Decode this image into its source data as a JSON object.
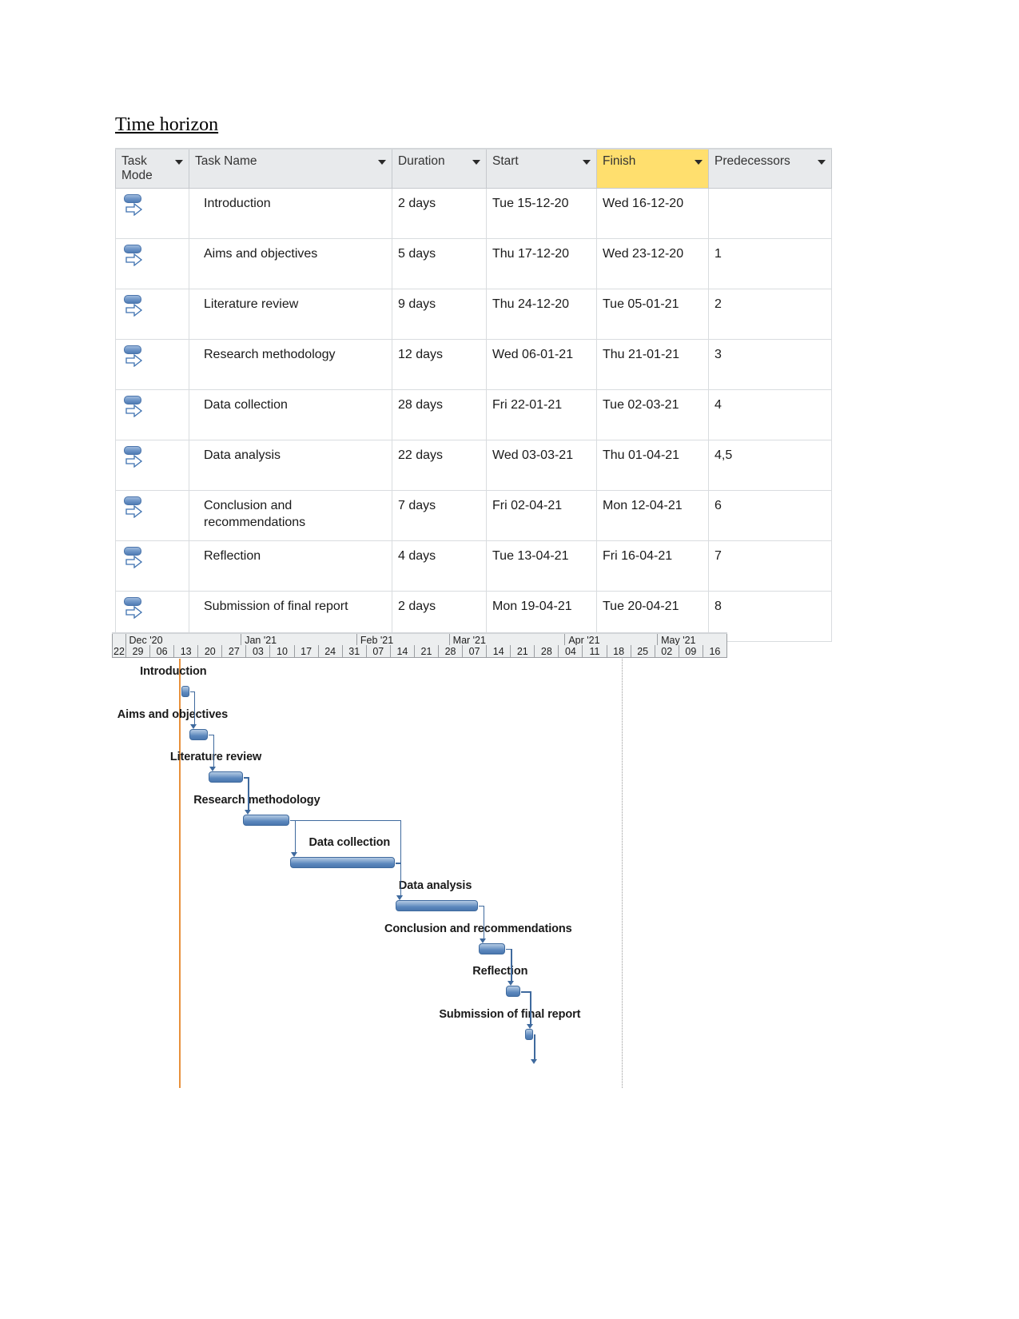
{
  "heading": "Time horizon",
  "grid": {
    "columns": [
      {
        "label": "Task Mode",
        "key": "mode",
        "has_filter": true,
        "highlight": false
      },
      {
        "label": "Task Name",
        "key": "name",
        "has_filter": true,
        "highlight": false
      },
      {
        "label": "Duration",
        "key": "duration",
        "has_filter": true,
        "highlight": false
      },
      {
        "label": "Start",
        "key": "start",
        "has_filter": true,
        "highlight": false
      },
      {
        "label": "Finish",
        "key": "finish",
        "has_filter": true,
        "highlight": true
      },
      {
        "label": "Predecessors",
        "key": "predecessors",
        "has_filter": true,
        "highlight": false
      }
    ],
    "finish_header_color": "#ffdf6e",
    "mode_icon": "auto-scheduled-icon",
    "rows": [
      {
        "id": 1,
        "name": "Introduction",
        "duration": "2 days",
        "start": "Tue 15-12-20",
        "finish": "Wed 16-12-20",
        "predecessors": ""
      },
      {
        "id": 2,
        "name": "Aims and objectives",
        "duration": "5 days",
        "start": "Thu 17-12-20",
        "finish": "Wed 23-12-20",
        "predecessors": "1"
      },
      {
        "id": 3,
        "name": "Literature review",
        "duration": "9 days",
        "start": "Thu 24-12-20",
        "finish": "Tue 05-01-21",
        "predecessors": "2"
      },
      {
        "id": 4,
        "name": "Research methodology",
        "duration": "12 days",
        "start": "Wed 06-01-21",
        "finish": "Thu 21-01-21",
        "predecessors": "3"
      },
      {
        "id": 5,
        "name": "Data collection",
        "duration": "28 days",
        "start": "Fri 22-01-21",
        "finish": "Tue 02-03-21",
        "predecessors": "4"
      },
      {
        "id": 6,
        "name": "Data analysis",
        "duration": "22 days",
        "start": "Wed 03-03-21",
        "finish": "Thu 01-04-21",
        "predecessors": "4,5"
      },
      {
        "id": 7,
        "name": "Conclusion and recommendations",
        "duration": "7 days",
        "start": "Fri 02-04-21",
        "finish": "Mon 12-04-21",
        "predecessors": "6"
      },
      {
        "id": 8,
        "name": "Reflection",
        "duration": "4 days",
        "start": "Tue 13-04-21",
        "finish": "Fri 16-04-21",
        "predecessors": "7"
      },
      {
        "id": 9,
        "name": "Submission of final report",
        "duration": "2 days",
        "start": "Mon 19-04-21",
        "finish": "Tue 20-04-21",
        "predecessors": "8"
      }
    ]
  },
  "chart_data": {
    "type": "bar",
    "title": "Time horizon",
    "chart_kind": "gantt",
    "xlabel": "",
    "ylabel": "",
    "grid": false,
    "legend": "none",
    "timescale": {
      "top_tier": "months",
      "bottom_tier": "weeks",
      "months": [
        {
          "label": "Dec '20",
          "weeks": 5
        },
        {
          "label": "Jan '21",
          "weeks": 5
        },
        {
          "label": "Feb '21",
          "weeks": 4
        },
        {
          "label": "Mar '21",
          "weeks": 5
        },
        {
          "label": "Apr '21",
          "weeks": 4
        },
        {
          "label": "May '21",
          "weeks": 3
        }
      ],
      "leading_partial_week": "22",
      "weeks": [
        "22",
        "29",
        "06",
        "13",
        "20",
        "27",
        "03",
        "10",
        "17",
        "24",
        "31",
        "07",
        "14",
        "21",
        "28",
        "07",
        "14",
        "21",
        "28",
        "04",
        "11",
        "18",
        "25",
        "02",
        "09",
        "16"
      ]
    },
    "markers": [
      {
        "name": "today-line",
        "label": "",
        "week_index": 3.2,
        "color": "#e8913c",
        "style": "solid"
      },
      {
        "name": "status-line",
        "label": "",
        "week_index": 21.6,
        "color": "#9a9a9a",
        "style": "dotted"
      }
    ],
    "tasks": [
      {
        "name": "Introduction",
        "start": "2020-12-15",
        "finish": "2020-12-16",
        "duration_days": 2,
        "bar_start_week": 3.3,
        "bar_span_weeks": 0.28
      },
      {
        "name": "Aims and objectives",
        "start": "2020-12-17",
        "finish": "2020-12-23",
        "duration_days": 5,
        "bar_start_week": 3.62,
        "bar_span_weeks": 0.78
      },
      {
        "name": "Literature review",
        "start": "2020-12-24",
        "finish": "2021-01-05",
        "duration_days": 9,
        "bar_start_week": 4.42,
        "bar_span_weeks": 1.42
      },
      {
        "name": "Research methodology",
        "start": "2021-01-06",
        "finish": "2021-01-21",
        "duration_days": 12,
        "bar_start_week": 5.86,
        "bar_span_weeks": 1.92
      },
      {
        "name": "Data collection",
        "start": "2021-01-22",
        "finish": "2021-03-02",
        "duration_days": 28,
        "bar_start_week": 7.8,
        "bar_span_weeks": 4.38
      },
      {
        "name": "Data analysis",
        "start": "2021-03-03",
        "finish": "2021-04-01",
        "duration_days": 22,
        "bar_start_week": 12.2,
        "bar_span_weeks": 3.44
      },
      {
        "name": "Conclusion and recommendations",
        "start": "2021-04-02",
        "finish": "2021-04-12",
        "duration_days": 7,
        "bar_start_week": 15.66,
        "bar_span_weeks": 1.1
      },
      {
        "name": "Reflection",
        "start": "2021-04-13",
        "finish": "2021-04-16",
        "duration_days": 4,
        "bar_start_week": 16.8,
        "bar_span_weeks": 0.6
      },
      {
        "name": "Submission of final report",
        "start": "2021-04-19",
        "finish": "2021-04-20",
        "duration_days": 2,
        "bar_start_week": 17.6,
        "bar_span_weeks": 0.3
      }
    ],
    "links": [
      {
        "from": "Introduction",
        "to": "Aims and objectives",
        "type": "FS"
      },
      {
        "from": "Aims and objectives",
        "to": "Literature review",
        "type": "FS"
      },
      {
        "from": "Literature review",
        "to": "Research methodology",
        "type": "FS"
      },
      {
        "from": "Research methodology",
        "to": "Data collection",
        "type": "FS"
      },
      {
        "from": "Research methodology",
        "to": "Data analysis",
        "type": "FS"
      },
      {
        "from": "Data collection",
        "to": "Data analysis",
        "type": "FS"
      },
      {
        "from": "Data analysis",
        "to": "Conclusion and recommendations",
        "type": "FS"
      },
      {
        "from": "Conclusion and recommendations",
        "to": "Reflection",
        "type": "FS"
      },
      {
        "from": "Reflection",
        "to": "Submission of final report",
        "type": "FS"
      }
    ],
    "bar_color": "#5b87bd",
    "bar_border_color": "#3f6a9e"
  }
}
